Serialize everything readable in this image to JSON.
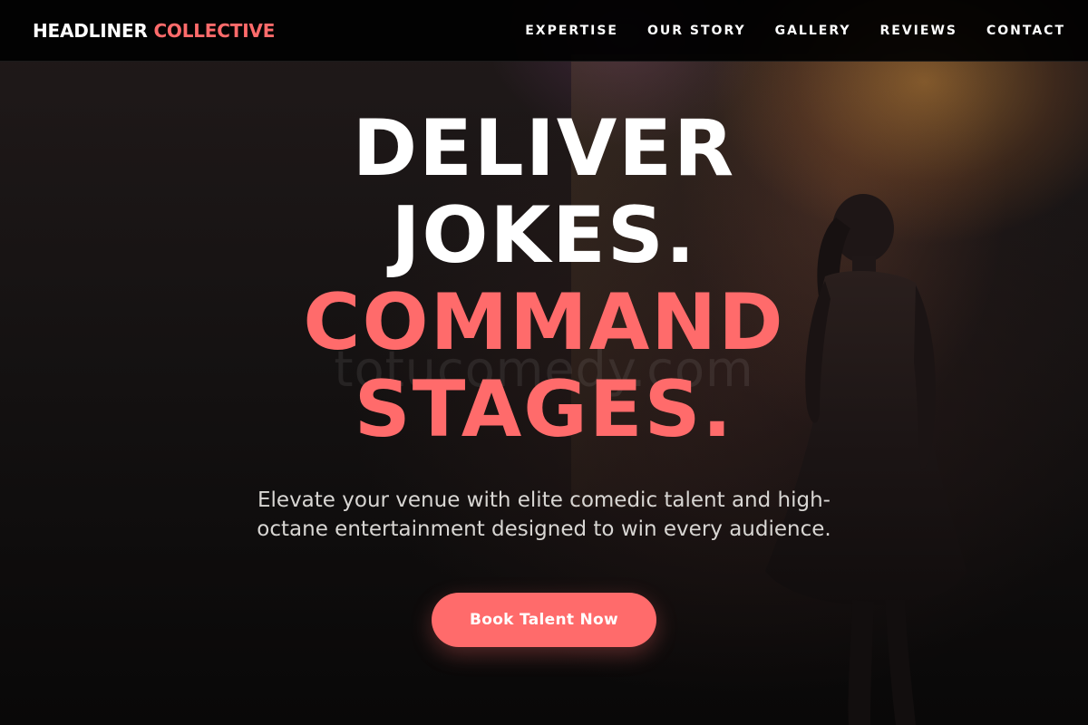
{
  "brand": {
    "primary": "HEADLINER",
    "accent": "COLLECTIVE"
  },
  "nav": {
    "items": [
      {
        "label": "EXPERTISE"
      },
      {
        "label": "OUR STORY"
      },
      {
        "label": "GALLERY"
      },
      {
        "label": "REVIEWS"
      },
      {
        "label": "CONTACT"
      }
    ]
  },
  "hero": {
    "headline": {
      "line1": "DELIVER",
      "line2": "JOKES.",
      "line3": "COMMAND",
      "line4": "STAGES."
    },
    "subtitle": "Elevate your venue with elite comedic talent and high-octane entertainment designed to win every audience.",
    "cta_label": "Book Talent Now",
    "watermark": "totucomedy.com"
  },
  "colors": {
    "accent": "#ff6b6b",
    "text": "#ffffff",
    "navbar_bg": "#000000",
    "page_bg": "#0b0909"
  }
}
